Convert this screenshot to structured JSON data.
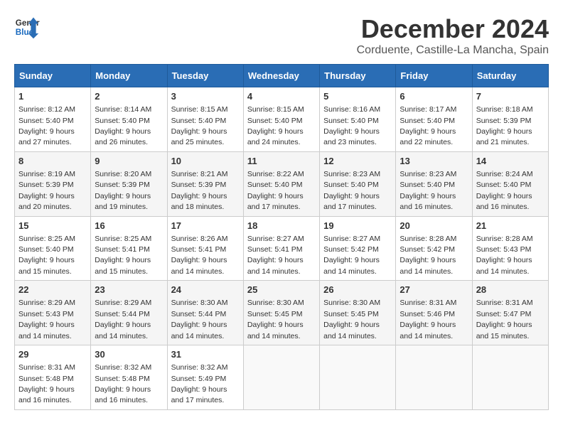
{
  "logo": {
    "line1": "General",
    "line2": "Blue"
  },
  "title": "December 2024",
  "subtitle": "Corduente, Castille-La Mancha, Spain",
  "days_of_week": [
    "Sunday",
    "Monday",
    "Tuesday",
    "Wednesday",
    "Thursday",
    "Friday",
    "Saturday"
  ],
  "weeks": [
    [
      {
        "day": 1,
        "sunrise": "8:12 AM",
        "sunset": "5:40 PM",
        "daylight": "9 hours and 27 minutes."
      },
      {
        "day": 2,
        "sunrise": "8:14 AM",
        "sunset": "5:40 PM",
        "daylight": "9 hours and 26 minutes."
      },
      {
        "day": 3,
        "sunrise": "8:15 AM",
        "sunset": "5:40 PM",
        "daylight": "9 hours and 25 minutes."
      },
      {
        "day": 4,
        "sunrise": "8:15 AM",
        "sunset": "5:40 PM",
        "daylight": "9 hours and 24 minutes."
      },
      {
        "day": 5,
        "sunrise": "8:16 AM",
        "sunset": "5:40 PM",
        "daylight": "9 hours and 23 minutes."
      },
      {
        "day": 6,
        "sunrise": "8:17 AM",
        "sunset": "5:40 PM",
        "daylight": "9 hours and 22 minutes."
      },
      {
        "day": 7,
        "sunrise": "8:18 AM",
        "sunset": "5:39 PM",
        "daylight": "9 hours and 21 minutes."
      }
    ],
    [
      {
        "day": 8,
        "sunrise": "8:19 AM",
        "sunset": "5:39 PM",
        "daylight": "9 hours and 20 minutes."
      },
      {
        "day": 9,
        "sunrise": "8:20 AM",
        "sunset": "5:39 PM",
        "daylight": "9 hours and 19 minutes."
      },
      {
        "day": 10,
        "sunrise": "8:21 AM",
        "sunset": "5:39 PM",
        "daylight": "9 hours and 18 minutes."
      },
      {
        "day": 11,
        "sunrise": "8:22 AM",
        "sunset": "5:40 PM",
        "daylight": "9 hours and 17 minutes."
      },
      {
        "day": 12,
        "sunrise": "8:23 AM",
        "sunset": "5:40 PM",
        "daylight": "9 hours and 17 minutes."
      },
      {
        "day": 13,
        "sunrise": "8:23 AM",
        "sunset": "5:40 PM",
        "daylight": "9 hours and 16 minutes."
      },
      {
        "day": 14,
        "sunrise": "8:24 AM",
        "sunset": "5:40 PM",
        "daylight": "9 hours and 16 minutes."
      }
    ],
    [
      {
        "day": 15,
        "sunrise": "8:25 AM",
        "sunset": "5:40 PM",
        "daylight": "9 hours and 15 minutes."
      },
      {
        "day": 16,
        "sunrise": "8:25 AM",
        "sunset": "5:41 PM",
        "daylight": "9 hours and 15 minutes."
      },
      {
        "day": 17,
        "sunrise": "8:26 AM",
        "sunset": "5:41 PM",
        "daylight": "9 hours and 14 minutes."
      },
      {
        "day": 18,
        "sunrise": "8:27 AM",
        "sunset": "5:41 PM",
        "daylight": "9 hours and 14 minutes."
      },
      {
        "day": 19,
        "sunrise": "8:27 AM",
        "sunset": "5:42 PM",
        "daylight": "9 hours and 14 minutes."
      },
      {
        "day": 20,
        "sunrise": "8:28 AM",
        "sunset": "5:42 PM",
        "daylight": "9 hours and 14 minutes."
      },
      {
        "day": 21,
        "sunrise": "8:28 AM",
        "sunset": "5:43 PM",
        "daylight": "9 hours and 14 minutes."
      }
    ],
    [
      {
        "day": 22,
        "sunrise": "8:29 AM",
        "sunset": "5:43 PM",
        "daylight": "9 hours and 14 minutes."
      },
      {
        "day": 23,
        "sunrise": "8:29 AM",
        "sunset": "5:44 PM",
        "daylight": "9 hours and 14 minutes."
      },
      {
        "day": 24,
        "sunrise": "8:30 AM",
        "sunset": "5:44 PM",
        "daylight": "9 hours and 14 minutes."
      },
      {
        "day": 25,
        "sunrise": "8:30 AM",
        "sunset": "5:45 PM",
        "daylight": "9 hours and 14 minutes."
      },
      {
        "day": 26,
        "sunrise": "8:30 AM",
        "sunset": "5:45 PM",
        "daylight": "9 hours and 14 minutes."
      },
      {
        "day": 27,
        "sunrise": "8:31 AM",
        "sunset": "5:46 PM",
        "daylight": "9 hours and 14 minutes."
      },
      {
        "day": 28,
        "sunrise": "8:31 AM",
        "sunset": "5:47 PM",
        "daylight": "9 hours and 15 minutes."
      }
    ],
    [
      {
        "day": 29,
        "sunrise": "8:31 AM",
        "sunset": "5:48 PM",
        "daylight": "9 hours and 16 minutes."
      },
      {
        "day": 30,
        "sunrise": "8:32 AM",
        "sunset": "5:48 PM",
        "daylight": "9 hours and 16 minutes."
      },
      {
        "day": 31,
        "sunrise": "8:32 AM",
        "sunset": "5:49 PM",
        "daylight": "9 hours and 17 minutes."
      },
      null,
      null,
      null,
      null
    ]
  ]
}
